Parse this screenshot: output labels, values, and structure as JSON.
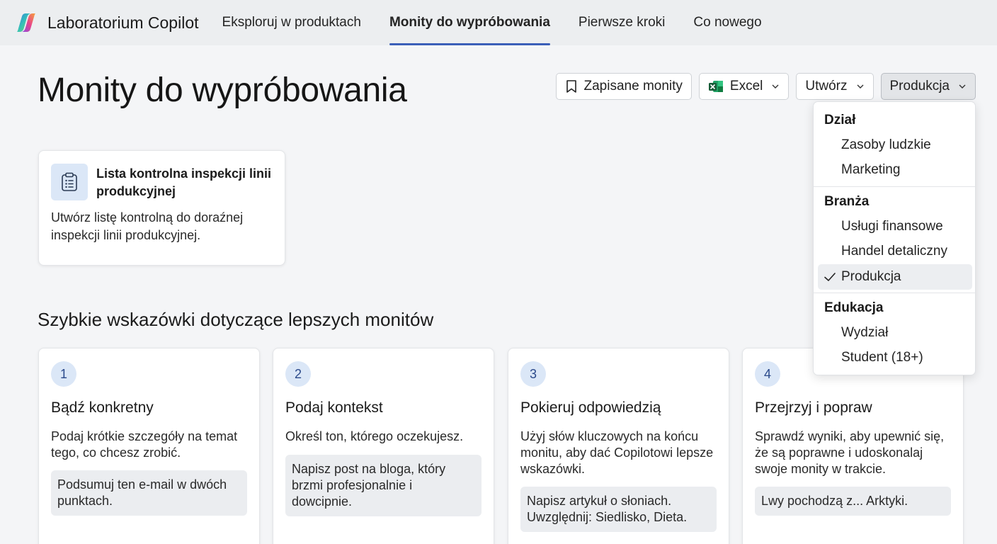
{
  "app": {
    "title": "Laboratorium Copilot"
  },
  "nav": {
    "items": [
      {
        "label": "Eksploruj w produktach",
        "active": false
      },
      {
        "label": "Monity do wypróbowania",
        "active": true
      },
      {
        "label": "Pierwsze kroki",
        "active": false
      },
      {
        "label": "Co nowego",
        "active": false
      }
    ]
  },
  "page": {
    "title": "Monity do wypróbowania"
  },
  "toolbar": {
    "saved_label": "Zapisane monity",
    "app_filter": "Excel",
    "action_filter": "Utwórz",
    "industry_filter": "Produkcja"
  },
  "prompt_card": {
    "title": "Lista kontrolna inspekcji linii produkcyjnej",
    "description": "Utwórz listę kontrolną do doraźnej inspekcji linii produkcyjnej."
  },
  "tips": {
    "section_title": "Szybkie wskazówki dotyczące lepszych monitów",
    "items": [
      {
        "number": "1",
        "title": "Bądź konkretny",
        "description": "Podaj krótkie szczegóły na temat tego, co chcesz zrobić.",
        "example": "Podsumuj ten e-mail w dwóch punktach."
      },
      {
        "number": "2",
        "title": "Podaj kontekst",
        "description": "Określ ton, którego oczekujesz.",
        "example": "Napisz post na bloga, który brzmi profesjonalnie i dowcipnie."
      },
      {
        "number": "3",
        "title": "Pokieruj odpowiedzią",
        "description": "Użyj słów kluczowych na końcu monitu, aby dać Copilotowi lepsze wskazówki.",
        "example": "Napisz artykuł o słoniach. Uwzględnij: Siedlisko, Dieta."
      },
      {
        "number": "4",
        "title": "Przejrzyj i popraw",
        "description": "Sprawdź wyniki, aby upewnić się, że są poprawne i udoskonalaj swoje monity w trakcie.",
        "example": "Lwy pochodzą z... Arktyki."
      }
    ]
  },
  "dropdown": {
    "groups": [
      {
        "title": "Dział",
        "items": [
          "Zasoby ludzkie",
          "Marketing"
        ]
      },
      {
        "title": "Branża",
        "items": [
          "Usługi finansowe",
          "Handel detaliczny",
          "Produkcja"
        ]
      },
      {
        "title": "Edukacja",
        "items": [
          "Wydział",
          "Student (18+)"
        ]
      }
    ],
    "selected": "Produkcja"
  },
  "colors": {
    "accent": "#3b5fb8",
    "excel_green": "#1d6f42",
    "icon_bg": "#dbe7f7"
  },
  "icons": {
    "brand": "copilot-logo",
    "saved": "bookmark-icon",
    "excel": "excel-icon",
    "chevron": "chevron-down-icon",
    "prompt": "clipboard-list-icon",
    "check": "checkmark-icon"
  }
}
